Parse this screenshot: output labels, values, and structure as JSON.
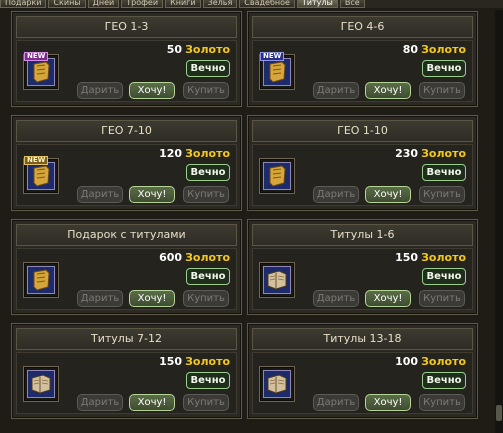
{
  "tabs": [
    "Подарки",
    "Скины",
    "Дней",
    "Трофеи",
    "Книги",
    "Зелья",
    "Свадебное",
    "Титулы",
    "Все"
  ],
  "active_tab_index": 7,
  "common": {
    "gift_label": "Дарить",
    "want_label": "Хочу!",
    "buy_label": "Купить",
    "duration_label": "Вечно",
    "currency": "Золото",
    "new_label": "NEW"
  },
  "cards": [
    {
      "title": "ГЕО 1-3",
      "price": "50",
      "new": true,
      "new_style": "purple",
      "icon": "scroll-icon"
    },
    {
      "title": "ГЕО 4-6",
      "price": "80",
      "new": true,
      "new_style": "blue",
      "icon": "scroll-icon"
    },
    {
      "title": "ГЕО 7-10",
      "price": "120",
      "new": true,
      "new_style": "gold",
      "icon": "scroll-icon"
    },
    {
      "title": "ГЕО 1-10",
      "price": "230",
      "new": false,
      "icon": "scroll-icon"
    },
    {
      "title": "Подарок с титулами",
      "price": "600",
      "new": false,
      "icon": "scroll-icon"
    },
    {
      "title": "Титулы 1-6",
      "price": "150",
      "new": false,
      "icon": "book-icon"
    },
    {
      "title": "Титулы 7-12",
      "price": "150",
      "new": false,
      "icon": "book-icon"
    },
    {
      "title": "Титулы 13-18",
      "price": "100",
      "new": false,
      "icon": "book-icon"
    }
  ]
}
